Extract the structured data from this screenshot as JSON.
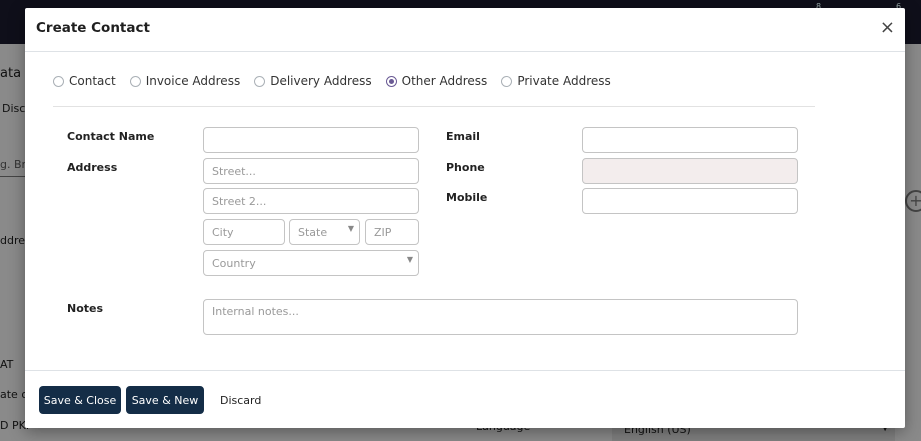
{
  "background": {
    "topbar_dots": [
      "8",
      "6"
    ],
    "left_texts": [
      "ata",
      "Disc",
      "g. Bra",
      "ddres",
      "AT",
      "ate o",
      "D PKF"
    ],
    "language_label": "Language",
    "language_value": "English (US)"
  },
  "modal": {
    "title": "Create Contact",
    "close": "×",
    "address_types": [
      {
        "label": "Contact",
        "checked": false
      },
      {
        "label": "Invoice Address",
        "checked": false
      },
      {
        "label": "Delivery Address",
        "checked": false
      },
      {
        "label": "Other Address",
        "checked": true
      },
      {
        "label": "Private Address",
        "checked": false
      }
    ],
    "form": {
      "contact_name_label": "Contact Name",
      "contact_name_value": "",
      "address_label": "Address",
      "street_placeholder": "Street...",
      "street2_placeholder": "Street 2...",
      "city_placeholder": "City",
      "state_placeholder": "State",
      "zip_placeholder": "ZIP",
      "country_placeholder": "Country",
      "email_label": "Email",
      "email_value": "",
      "phone_label": "Phone",
      "phone_value": "",
      "mobile_label": "Mobile",
      "mobile_value": "",
      "notes_label": "Notes",
      "notes_placeholder": "Internal notes..."
    },
    "footer": {
      "save_close": "Save & Close",
      "save_new": "Save & New",
      "discard": "Discard"
    }
  }
}
